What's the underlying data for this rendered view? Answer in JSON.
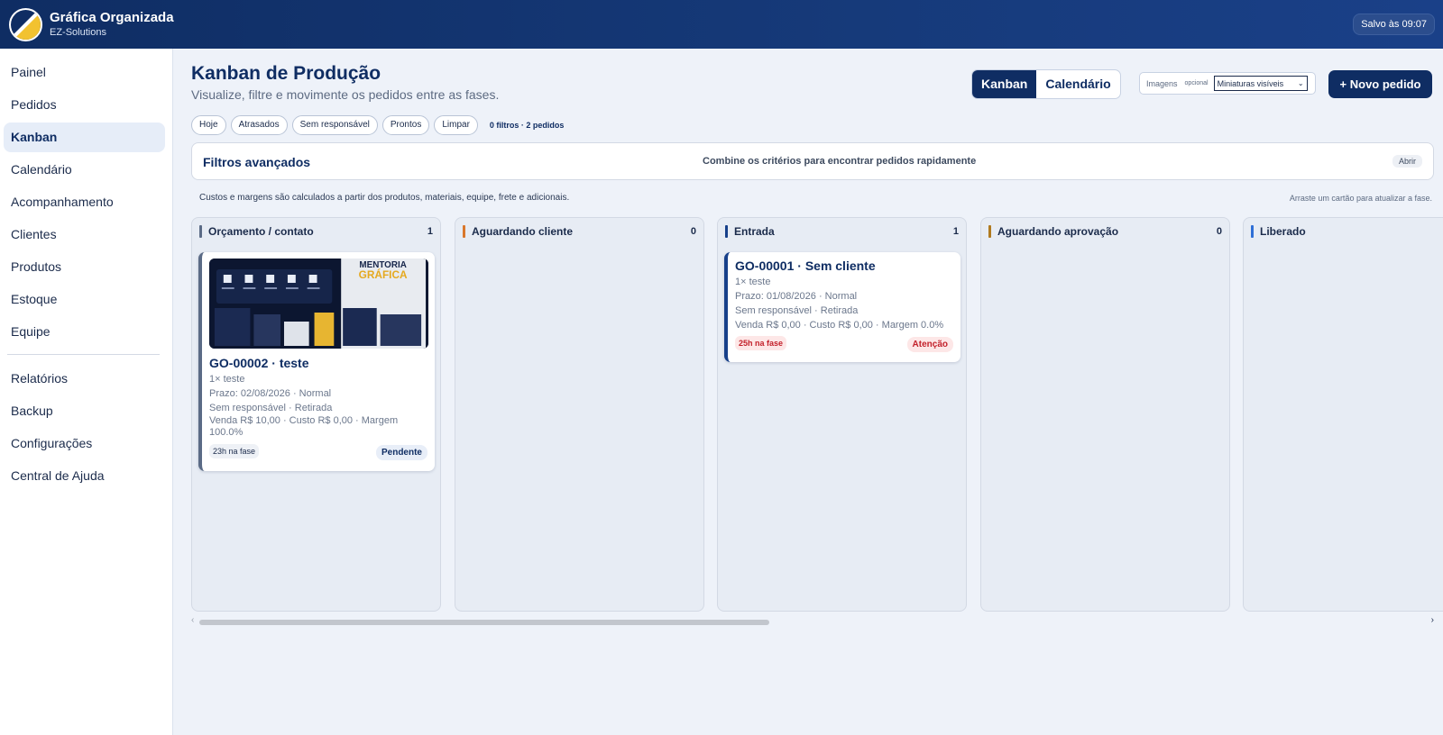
{
  "header": {
    "app_name": "Gráfica Organizada",
    "company": "EZ-Solutions",
    "saved_status": "Salvo às 09:07"
  },
  "sidebar": {
    "items": [
      {
        "label": "Painel"
      },
      {
        "label": "Pedidos"
      },
      {
        "label": "Kanban",
        "active": true
      },
      {
        "label": "Calendário"
      },
      {
        "label": "Acompanhamento"
      },
      {
        "label": "Clientes"
      },
      {
        "label": "Produtos"
      },
      {
        "label": "Estoque"
      },
      {
        "label": "Equipe"
      }
    ],
    "items_secondary": [
      {
        "label": "Relatórios"
      },
      {
        "label": "Backup"
      },
      {
        "label": "Configurações"
      },
      {
        "label": "Central de Ajuda"
      }
    ]
  },
  "page": {
    "title": "Kanban de Produção",
    "subtitle": "Visualize, filtre e movimente os pedidos entre as fases."
  },
  "view_toggle": {
    "kanban": "Kanban",
    "calendar": "Calendário",
    "active": "kanban"
  },
  "images": {
    "label": "Imagens",
    "optional": "opcional",
    "selected": "Miniaturas visíveis"
  },
  "new_order_label": "+ Novo pedido",
  "quick_filters": {
    "chips": [
      "Hoje",
      "Atrasados",
      "Sem responsável",
      "Prontos",
      "Limpar"
    ],
    "summary": "0 filtros · 2 pedidos"
  },
  "advanced_filters": {
    "title": "Filtros avançados",
    "hint": "Combine os critérios para encontrar pedidos rapidamente",
    "toggle": "Abrir"
  },
  "notes": {
    "costs": "Custos e margens são calculados a partir dos produtos, materiais, equipe, frete e adicionais.",
    "drag": "Arraste um cartão para atualizar a fase."
  },
  "colors": {
    "primary": "#0f2d63",
    "stage_orcamento": "#5b6b86",
    "stage_aguardando_cliente": "#d9772b",
    "stage_entrada": "#17408a",
    "stage_aguardando_aprovacao": "#b07a1e",
    "stage_liberado": "#2f6fd6",
    "warning": "#c3212b"
  },
  "columns": [
    {
      "name": "Orçamento / contato",
      "count": "1",
      "cards": [
        {
          "title": "GO-00002 · teste",
          "items": "1× teste",
          "deadline": "Prazo: 02/08/2026 · Normal",
          "assignee": "Sem responsável · Retirada",
          "finance": "Venda R$ 10,00 · Custo R$ 0,00 · Margem 100.0%",
          "age": "23h na fase",
          "status": "Pendente",
          "thumbnail_text": "MENTORIA GRÁFICA"
        }
      ]
    },
    {
      "name": "Aguardando cliente",
      "count": "0",
      "cards": []
    },
    {
      "name": "Entrada",
      "count": "1",
      "cards": [
        {
          "title": "GO-00001 · Sem cliente",
          "items": "1× teste",
          "deadline": "Prazo: 01/08/2026 · Normal",
          "assignee": "Sem responsável · Retirada",
          "finance": "Venda R$ 0,00 · Custo R$ 0,00 · Margem 0.0%",
          "age": "25h na fase",
          "status": "Atenção"
        }
      ]
    },
    {
      "name": "Aguardando aprovação",
      "count": "0",
      "cards": []
    },
    {
      "name": "Liberado",
      "count": "",
      "cards": []
    }
  ],
  "scroll": {
    "left_arrow": "‹",
    "right_arrow": "›"
  }
}
